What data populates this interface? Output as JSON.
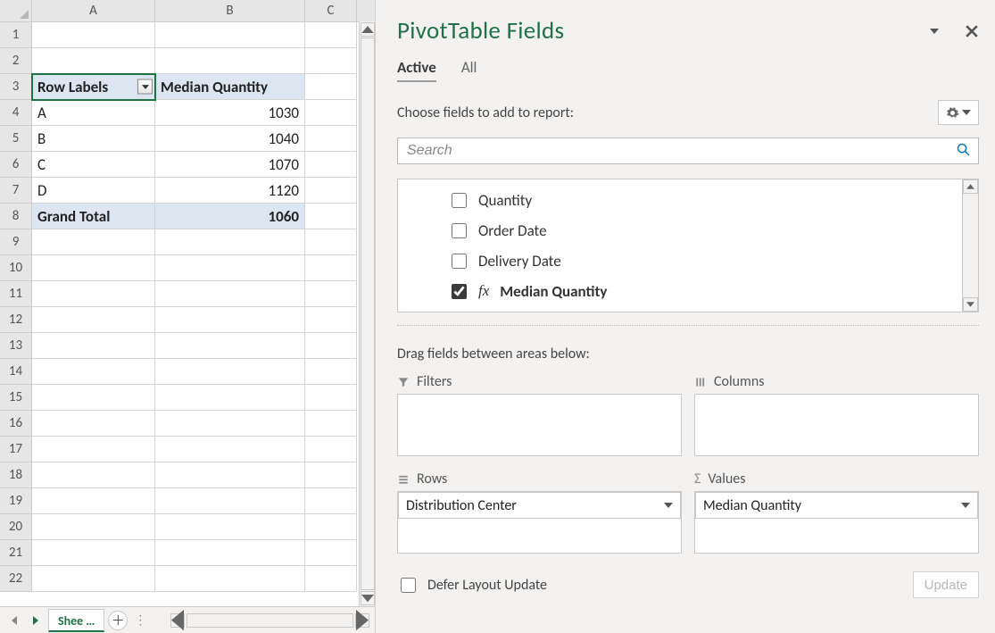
{
  "grid": {
    "columns": [
      "A",
      "B",
      "C"
    ],
    "row_numbers": [
      1,
      2,
      3,
      4,
      5,
      6,
      7,
      8,
      9,
      10,
      11,
      12,
      13,
      14,
      15,
      16,
      17,
      18,
      19,
      20,
      21,
      22
    ],
    "pivot": {
      "header_row_label": "Row Labels",
      "header_value_label": "Median Quantity",
      "rows": [
        {
          "label": "A",
          "value": 1030
        },
        {
          "label": "B",
          "value": 1040
        },
        {
          "label": "C",
          "value": 1070
        },
        {
          "label": "D",
          "value": 1120
        }
      ],
      "grand_total_label": "Grand Total",
      "grand_total_value": 1060
    },
    "sheet_tab": "Shee …"
  },
  "pane": {
    "title": "PivotTable Fields",
    "tab_active": "Active",
    "tab_all": "All",
    "choose_label": "Choose fields to add to report:",
    "search_placeholder": "Search",
    "fields": [
      {
        "label": "Quantity",
        "checked": false,
        "fx": false
      },
      {
        "label": "Order Date",
        "checked": false,
        "fx": false
      },
      {
        "label": "Delivery Date",
        "checked": false,
        "fx": false
      },
      {
        "label": "Median Quantity",
        "checked": true,
        "fx": true
      }
    ],
    "drag_label": "Drag fields between areas below:",
    "area_filters": "Filters",
    "area_columns": "Columns",
    "area_rows": "Rows",
    "area_values": "Values",
    "rows_chip": "Distribution Center",
    "values_chip": "Median Quantity",
    "defer_label": "Defer Layout Update",
    "update_label": "Update"
  }
}
